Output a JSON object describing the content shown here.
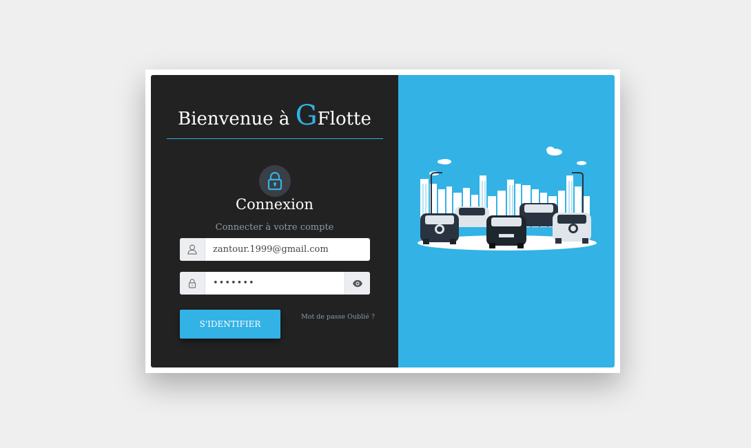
{
  "header": {
    "welcome_prefix": "Bienvenue à ",
    "brand_initial": "G",
    "brand_rest": "Flotte"
  },
  "login": {
    "title": "Connexion",
    "subtitle": "Connecter à votre compte",
    "email_value": "zantour.1999@gmail.com",
    "password_value": "•••••••",
    "submit_label": "S'IDENTIFIER",
    "forgot_label": "Mot de passe Oublié ?"
  },
  "icons": {
    "lock": "lock-icon",
    "user": "user-icon",
    "password": "padlock-icon",
    "toggle": "eye-icon",
    "illustration": "city-cars-illustration"
  },
  "colors": {
    "accent": "#33b2e5",
    "panel_dark": "#222222",
    "background": "#efefef"
  }
}
